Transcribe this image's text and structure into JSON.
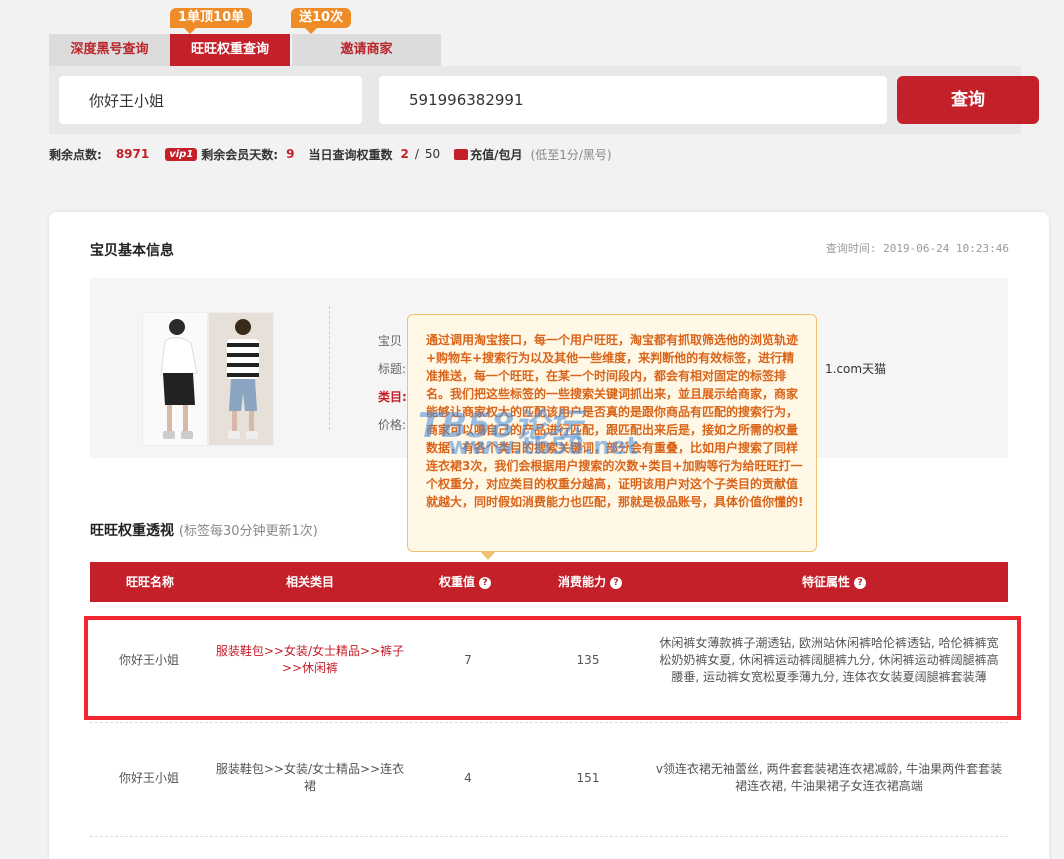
{
  "tabs": {
    "badges": [
      "1单顶10单",
      "送10次"
    ],
    "items": [
      "深度黑号查询",
      "旺旺权重查询",
      "邀请商家"
    ],
    "active_index": 1
  },
  "search": {
    "wangwang_value": "你好王小姐",
    "id_value": "591996382991",
    "query_label": "查询"
  },
  "stats": {
    "points_label": "剩余点数:",
    "points_value": "8971",
    "vip_badge": "vip1",
    "member_days_label": "剩余会员天数:",
    "member_days_value": "9",
    "daily_label": "当日查询权重数",
    "daily_used": "2",
    "daily_sep": "/",
    "daily_total": "50",
    "recharge_label": "充值/包月",
    "price_note": "(低至1分/黑号)"
  },
  "card": {
    "title": "宝贝基本信息",
    "query_time": "查询时间: 2019-06-24 10:23:46",
    "info_labels": [
      "宝贝",
      "标题:",
      "类目:",
      "价格:"
    ],
    "shop_tail": "1.com天猫"
  },
  "section": {
    "title": "旺旺权重透视",
    "subtitle": "(标签每30分钟更新1次)"
  },
  "table": {
    "headers": [
      "旺旺名称",
      "相关类目",
      "权重值",
      "消费能力",
      "特征属性"
    ],
    "help_icon": "?",
    "rows": [
      {
        "name": "你好王小姐",
        "category": "服装鞋包>>女装/女士精品>>裤子>>休闲裤",
        "weight": "7",
        "spending": "135",
        "features": "休闲裤女薄款裤子潮透钻, 欧洲站休闲裤哈伦裤透钻, 哈伦裤裤宽松奶奶裤女夏, 休闲裤运动裤阔腿裤九分, 休闲裤运动裤阔腿裤高腰垂, 运动裤女宽松夏季薄九分, 连体衣女装夏阔腿裤套装薄"
      },
      {
        "name": "你好王小姐",
        "category": "服装鞋包>>女装/女士精品>>连衣裙",
        "weight": "4",
        "spending": "151",
        "features": "v领连衣裙无袖蕾丝, 两件套套装裙连衣裙减龄, 牛油果两件套套装裙连衣裙, 牛油果裙子女连衣裙高端"
      }
    ]
  },
  "tooltip": {
    "text": "通过调用淘宝接口，每一个用户旺旺，淘宝都有抓取筛选他的浏览轨迹+购物车+搜索行为以及其他一些维度，来判断他的有效标签，进行精准推送，每一个旺旺，在某一个时间段内，都会有相对固定的标签排名。我们把这些标签的一些搜索关键词抓出来，並且展示给商家，商家能够让商家权大的匹配该用户是否真的是跟你商品有匹配的搜索行为，商家可以鳴自己的产品进行匹配，跟匹配出来后是，接如之所需的权量数据，有各个类目的搜索关键词，部分会有重叠，比如用户搜索了同样连衣裙3次，我们会根据用户搜索的次数+类目+加购等行为给旺旺打一个权重分，对应类目的权重分越高，证明该用户对这个子类目的贡献值就越大，同时假如消费能力也匹配，那就是极品账号，具体价值你懂的!"
  },
  "watermark": {
    "line1": "TB58论坛",
    "line2": "www.tb58.net"
  },
  "colors": {
    "brand_red": "#c4202a",
    "orange": "#f08c28",
    "highlight_border": "#f0262f",
    "tooltip_text": "#d9641a"
  }
}
